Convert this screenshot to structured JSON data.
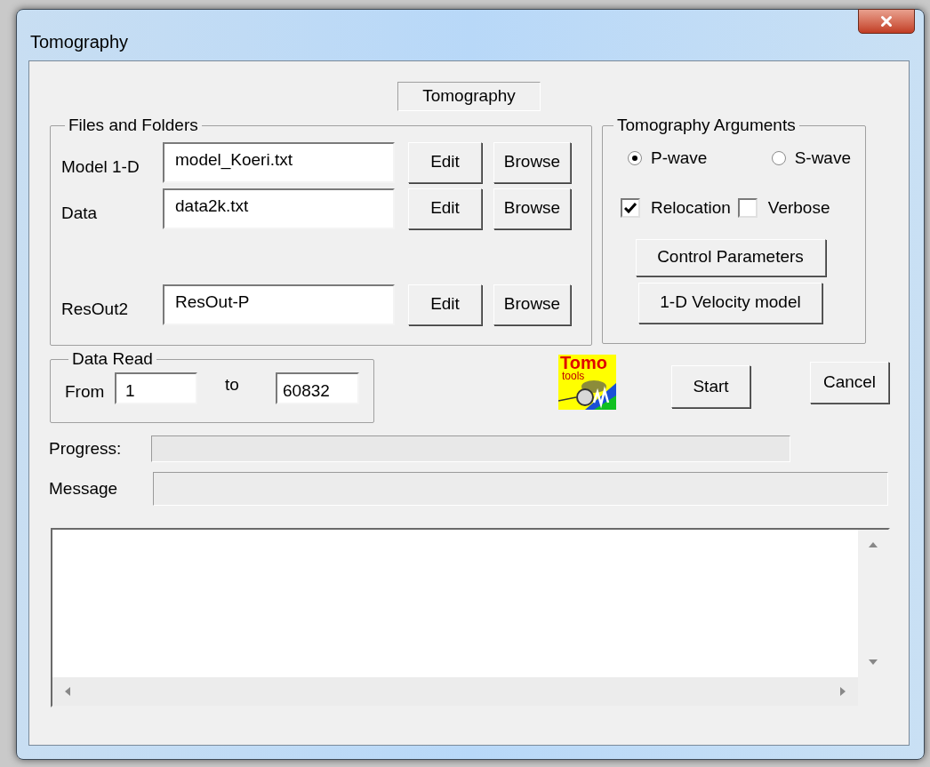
{
  "window": {
    "title": "Tomography"
  },
  "tab": {
    "label": "Tomography",
    "selected": true
  },
  "files_group": {
    "title": "Files and Folders",
    "rows": [
      {
        "label": "Model 1-D",
        "value": "model_Koeri.txt",
        "buttons": [
          "Edit",
          "Browse"
        ]
      },
      {
        "label": "Data",
        "value": "data2k.txt",
        "buttons": [
          "Edit",
          "Browse"
        ]
      },
      {
        "label": "ResOut2",
        "value": "ResOut-P",
        "buttons": [
          "Edit",
          "Browse"
        ]
      }
    ]
  },
  "arguments_group": {
    "title": "Tomography Arguments",
    "radios": [
      {
        "label": "P-wave",
        "selected": true
      },
      {
        "label": "S-wave",
        "selected": false
      }
    ],
    "checkboxes": [
      {
        "label": "Relocation",
        "checked": true
      },
      {
        "label": "Verbose",
        "checked": false
      }
    ],
    "buttons": [
      "Control Parameters",
      "1-D Velocity model"
    ]
  },
  "data_read": {
    "title": "Data Read",
    "from_label": "From",
    "from_value": "1",
    "to_label": "to",
    "to_value": "60832"
  },
  "logo": {
    "line1": "Tomo",
    "line2": "tools"
  },
  "actions": [
    "Start",
    "Cancel"
  ],
  "progress": {
    "label": "Progress:",
    "level": 0
  },
  "message": {
    "label": "Message"
  }
}
